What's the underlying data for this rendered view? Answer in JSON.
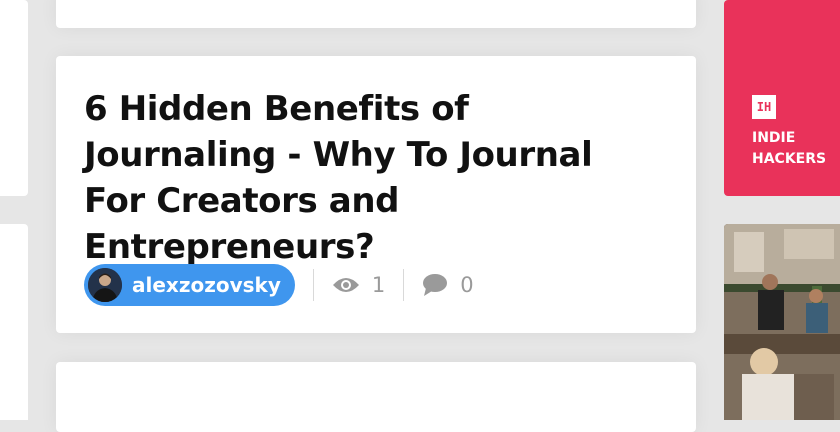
{
  "article": {
    "title": "6 Hidden Benefits of Journaling - Why To Journal For Creators and Entrepreneurs?",
    "author": "alexzozovsky",
    "views": "1",
    "comments": "0"
  },
  "sidebar": {
    "brand_logo": "IH",
    "brand_line1": "INDIE",
    "brand_line2": "HACKERS",
    "brand_color": "#e9325a",
    "accent_color": "#3f96ee"
  },
  "icons": {
    "views": "eye-icon",
    "comments": "speech-bubble-icon"
  }
}
